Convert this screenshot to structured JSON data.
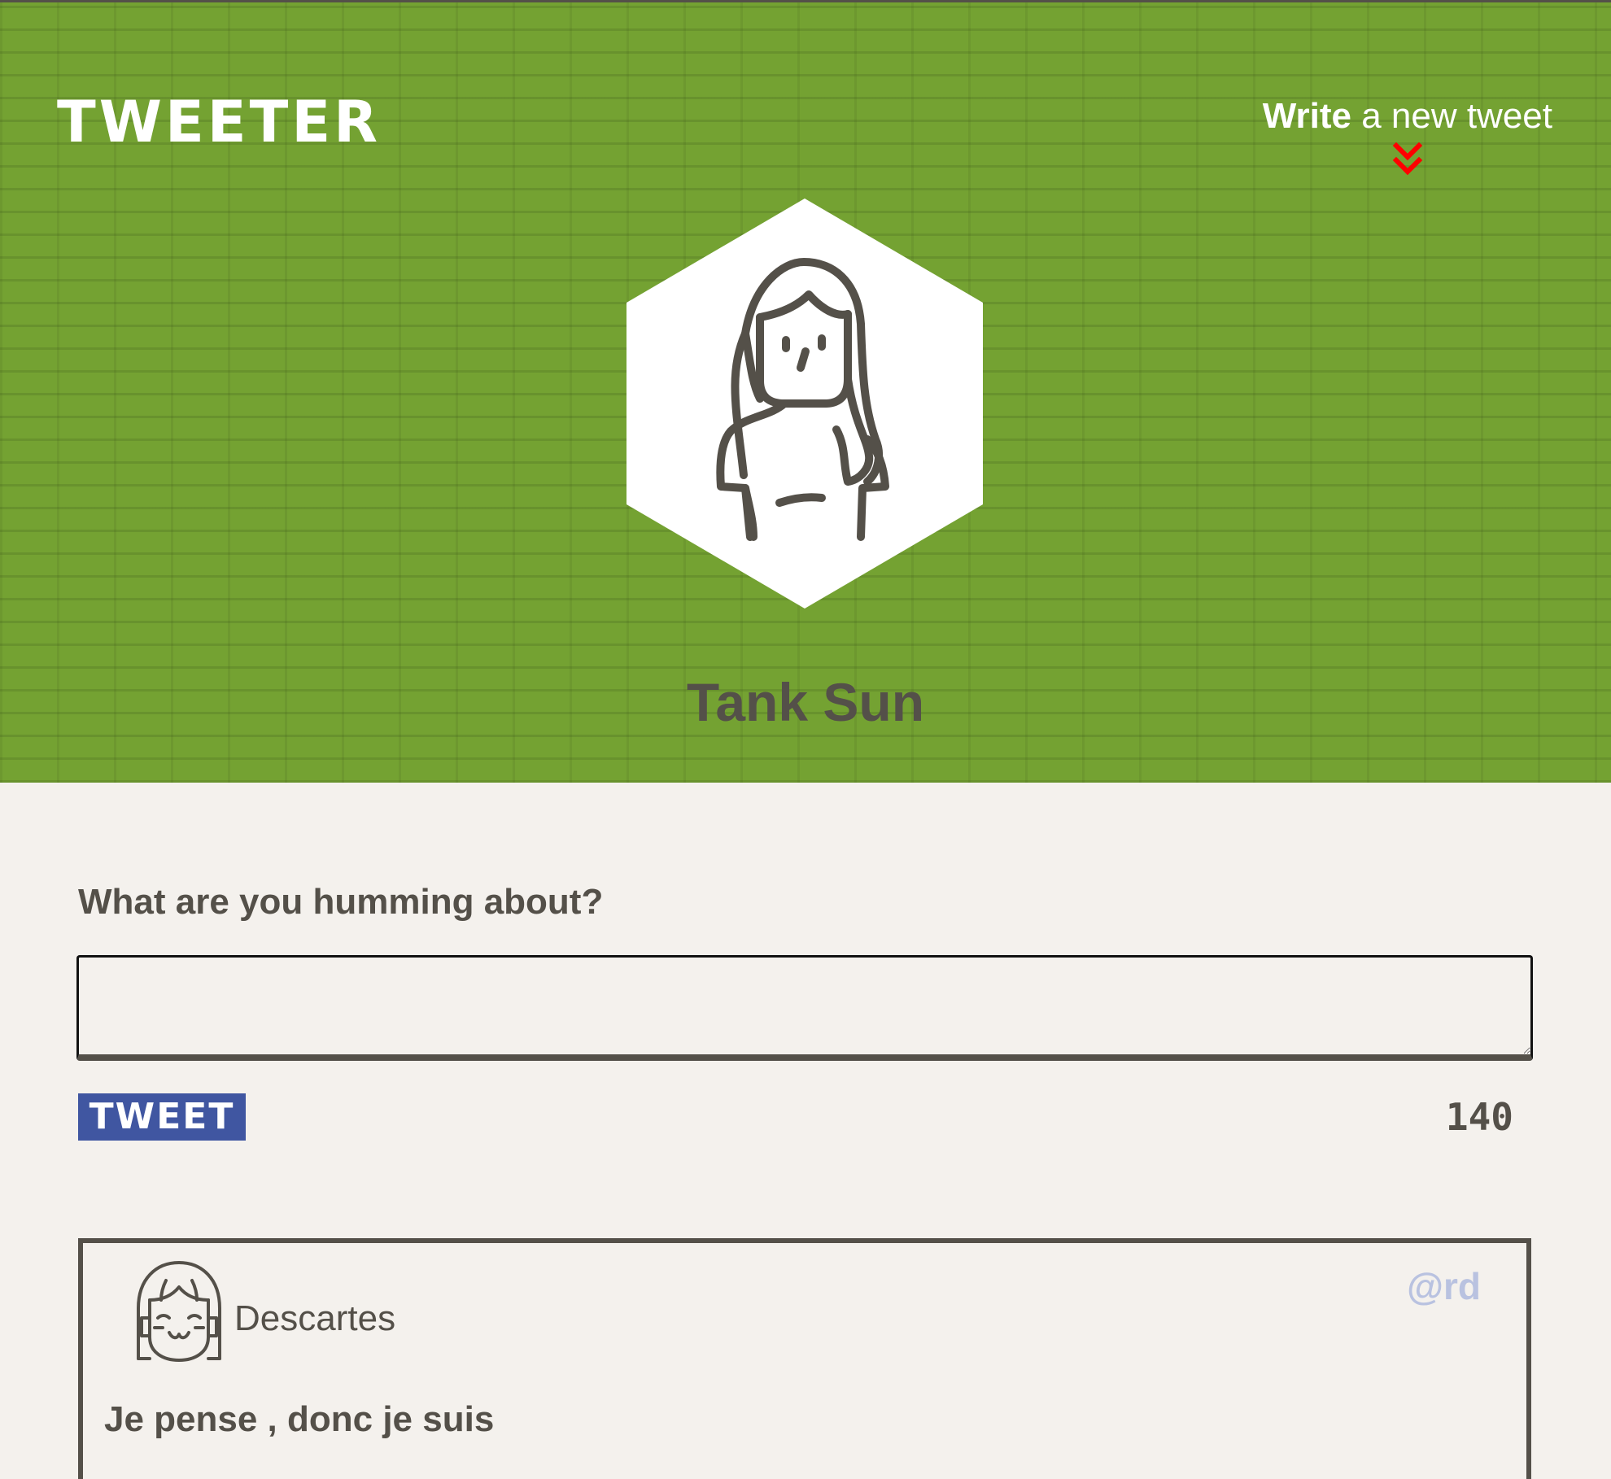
{
  "app": {
    "brand": "TWEETER"
  },
  "nav": {
    "compose_bold": "Write",
    "compose_rest": " a new tweet",
    "chevron_icon": "double-chevron-down-icon",
    "chevron_color": "#ff0000"
  },
  "profile": {
    "name": "Tank Sun",
    "avatar_icon": "woman-avatar-icon"
  },
  "compose": {
    "label": "What are you humming about?",
    "input_value": "",
    "placeholder": "",
    "button_label": "TWEET",
    "counter": "140"
  },
  "tweets": [
    {
      "author": "Descartes",
      "handle": "@rd",
      "text": "Je pense , donc je suis",
      "avatar_icon": "smiling-girl-avatar-icon"
    }
  ],
  "colors": {
    "header_green": "#74a232",
    "page_bg": "#f4f1ed",
    "text_dark": "#545049",
    "button_blue": "#4056a1",
    "handle_color": "#b9c2e0"
  }
}
